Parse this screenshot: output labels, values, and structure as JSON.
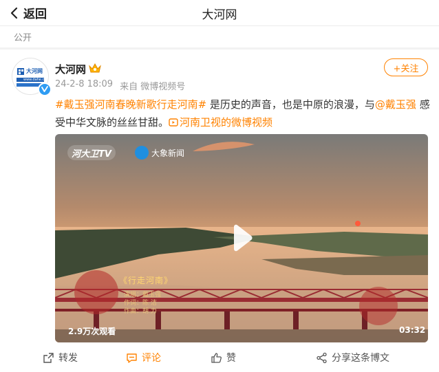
{
  "header": {
    "back_label": "返回",
    "title": "大河网"
  },
  "post": {
    "visibility": "公开",
    "author": {
      "name": "大河网",
      "avatar_text": "大河网",
      "avatar_sub": "www.dahe.cn"
    },
    "time": "24-2-8 18:09",
    "source": "来自 微博视频号",
    "follow_label": "+关注",
    "content": {
      "topic": "#戴玉强河南春晚新歌行走河南#",
      "text1": " 是历史的声音，也是中原的浪漫，与",
      "mention": "@戴玉强",
      "text2": " 感受中华文脉的丝丝甘甜。",
      "video_link": "河南卫视的微博视频"
    },
    "video": {
      "logo1": "河大卫TV",
      "logo2": "大象新闻",
      "song_title": "《行走河南》",
      "credits": [
        "演唱：戴玉强",
        "作词：陈 洁",
        "作曲：胡 力"
      ],
      "views": "2.9万次观看",
      "duration": "03:32"
    },
    "actions": {
      "repost": "转发",
      "comment": "评论",
      "like": "赞",
      "share": "分享这条博文"
    }
  },
  "colors": {
    "accent": "#ff8200",
    "verified": "#2f9cf3"
  }
}
